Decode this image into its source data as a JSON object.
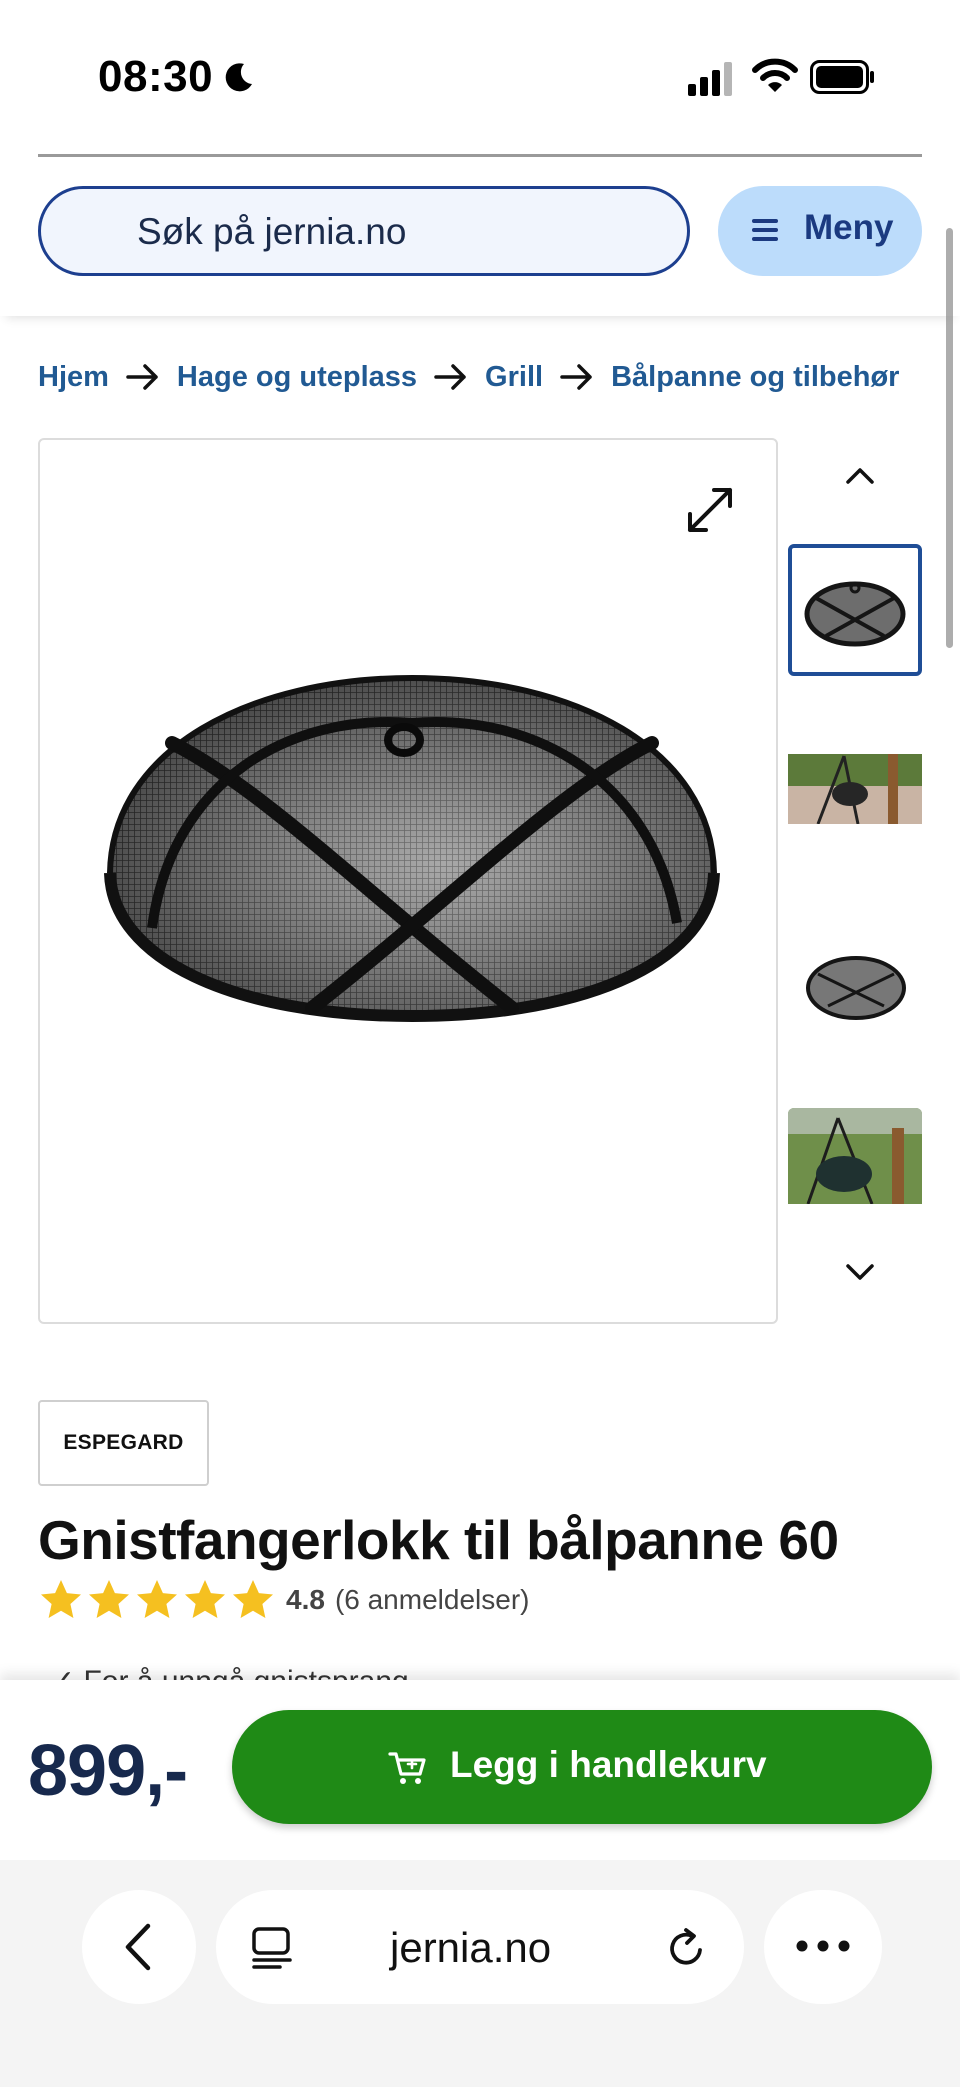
{
  "status_bar": {
    "time": "08:30"
  },
  "header": {
    "search_placeholder": "Søk på jernia.no",
    "menu_label": "Meny"
  },
  "breadcrumb": [
    "Hjem",
    "Hage og uteplass",
    "Grill",
    "Bålpanne og tilbehør"
  ],
  "product": {
    "brand": "ESPEGARD",
    "title": "Gnistfangerlokk til bålpanne 60",
    "rating": {
      "value": "4.8",
      "count_text": "(6 anmeldelser)",
      "stars": 5
    },
    "usp_partial": "✓ For å unngå gnistsprang",
    "price": "899,-"
  },
  "buy": {
    "cart_label": "Legg i handlekurv"
  },
  "browser": {
    "url": "jernia.no"
  },
  "colors": {
    "brand_blue": "#1d3f8f",
    "link_blue": "#215a93",
    "menu_bg": "#bcdcfb",
    "cart_green": "#1f8a16",
    "star_gold": "#f5c020",
    "price_navy": "#17294d"
  }
}
